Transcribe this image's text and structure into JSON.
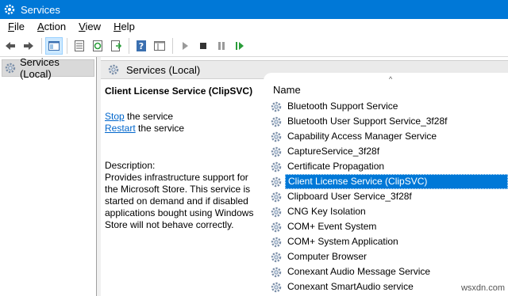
{
  "window": {
    "title": "Services",
    "accent_color": "#0078d7"
  },
  "menu": {
    "items": [
      "File",
      "Action",
      "View",
      "Help"
    ]
  },
  "toolbar": {
    "buttons": [
      "back-icon",
      "forward-icon",
      "console-tree-icon",
      "properties-icon",
      "refresh-icon",
      "export-icon",
      "help-icon",
      "view-icon",
      "start-icon",
      "stop-icon",
      "pause-icon",
      "restart-icon"
    ]
  },
  "tree": {
    "root_label": "Services (Local)"
  },
  "panel": {
    "header_title": "Services (Local)",
    "selected_service_title": "Client License Service (ClipSVC)",
    "stop_link": "Stop",
    "stop_suffix": " the service",
    "restart_link": "Restart",
    "restart_suffix": " the service",
    "description_label": "Description:",
    "description_text": "Provides infrastructure support for the Microsoft Store. This service is started on demand and if disabled applications bought using Windows Store will not behave correctly."
  },
  "list": {
    "column_header": "Name",
    "sort_indicator": "^",
    "services": [
      {
        "name": "Bluetooth Support Service",
        "selected": false
      },
      {
        "name": "Bluetooth User Support Service_3f28f",
        "selected": false
      },
      {
        "name": "Capability Access Manager Service",
        "selected": false
      },
      {
        "name": "CaptureService_3f28f",
        "selected": false
      },
      {
        "name": "Certificate Propagation",
        "selected": false
      },
      {
        "name": "Client License Service (ClipSVC)",
        "selected": true
      },
      {
        "name": "Clipboard User Service_3f28f",
        "selected": false
      },
      {
        "name": "CNG Key Isolation",
        "selected": false
      },
      {
        "name": "COM+ Event System",
        "selected": false
      },
      {
        "name": "COM+ System Application",
        "selected": false
      },
      {
        "name": "Computer Browser",
        "selected": false
      },
      {
        "name": "Conexant Audio Message Service",
        "selected": false
      },
      {
        "name": "Conexant SmartAudio service",
        "selected": false
      }
    ]
  },
  "watermark": "wsxdn.com"
}
